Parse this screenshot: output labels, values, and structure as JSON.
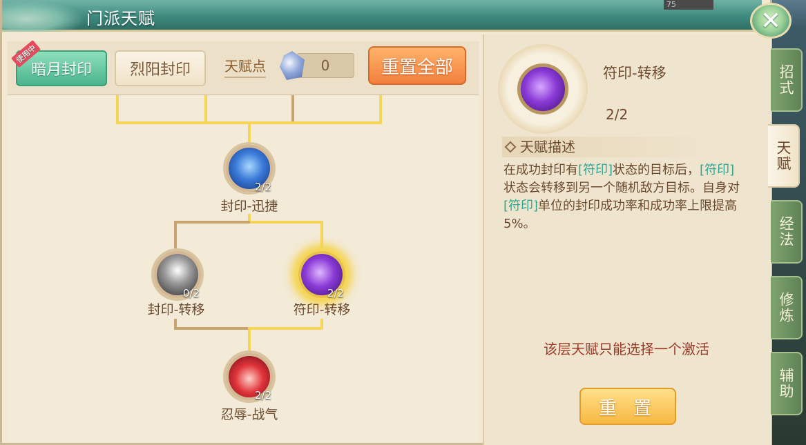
{
  "window": {
    "title": "门派天赋",
    "top_counter": "75"
  },
  "tabs": [
    {
      "label": "暗月封印",
      "badge": "使用中",
      "active": true
    },
    {
      "label": "烈阳封印",
      "active": false
    }
  ],
  "points": {
    "label": "天赋点",
    "value": "0"
  },
  "reset_all_label": "重置全部",
  "tree": {
    "nodes": [
      {
        "name": "封印-迅捷",
        "level": "2/2"
      },
      {
        "name": "封印-转移",
        "level": "0/2"
      },
      {
        "name": "符印-转移",
        "level": "2/2"
      },
      {
        "name": "忍辱-战气",
        "level": "2/2"
      }
    ]
  },
  "detail": {
    "name": "符印-转移",
    "level": "2/2",
    "desc_header": "天赋描述",
    "desc_parts": [
      "在成功封印有",
      "[符印]",
      "状态的目标后，",
      "[符印]",
      "状态会转移到另一个随机敌方目标。自身对",
      "[符印]",
      "单位的封印成功率和成功率上限提高5%。"
    ],
    "notice": "该层天赋只能选择一个激活",
    "reset_label": "重 置"
  },
  "side_tabs": [
    "招式",
    "天赋",
    "经法",
    "修炼",
    "辅助"
  ],
  "colors": {
    "highlight_text": "#2ea58f",
    "accent_green": "#4bb48d",
    "accent_orange": "#f2803e"
  }
}
